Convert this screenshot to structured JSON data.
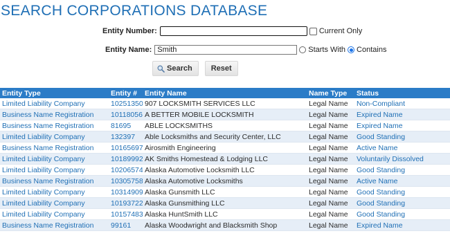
{
  "page": {
    "title": "SEARCH CORPORATIONS DATABASE"
  },
  "form": {
    "entity_number_label": "Entity Number:",
    "entity_number_value": "",
    "current_only_label": "Current Only",
    "current_only_checked": false,
    "entity_name_label": "Entity Name:",
    "entity_name_value": "Smith",
    "starts_with_label": "Starts With",
    "contains_label": "Contains",
    "match_mode": "Contains",
    "search_button": "Search",
    "reset_button": "Reset"
  },
  "table": {
    "headers": [
      "Entity Type",
      "Entity #",
      "Entity Name",
      "Name Type",
      "Status"
    ],
    "rows": [
      [
        "Limited Liability Company",
        "10251350",
        "907 LOCKSMITH SERVICES LLC",
        "Legal Name",
        "Non-Compliant"
      ],
      [
        "Business Name Registration",
        "10118056",
        "A BETTER MOBILE LOCKSMITH",
        "Legal Name",
        "Expired Name"
      ],
      [
        "Business Name Registration",
        "81695",
        "ABLE LOCKSMITHS",
        "Legal Name",
        "Expired Name"
      ],
      [
        "Limited Liability Company",
        "132397",
        "Able Locksmiths and Security Center, LLC",
        "Legal Name",
        "Good Standing"
      ],
      [
        "Business Name Registration",
        "10165697",
        "Airosmith Engineering",
        "Legal Name",
        "Active Name"
      ],
      [
        "Limited Liability Company",
        "10189992",
        "AK Smiths Homestead & Lodging LLC",
        "Legal Name",
        "Voluntarily Dissolved"
      ],
      [
        "Limited Liability Company",
        "10206574",
        "Alaska Automotive Locksmith LLC",
        "Legal Name",
        "Good Standing"
      ],
      [
        "Business Name Registration",
        "10305758",
        "Alaska Automotive Locksmiths",
        "Legal Name",
        "Active Name"
      ],
      [
        "Limited Liability Company",
        "10314909",
        "Alaska Gunsmith LLC",
        "Legal Name",
        "Good Standing"
      ],
      [
        "Limited Liability Company",
        "10193722",
        "Alaska Gunsmithing LLC",
        "Legal Name",
        "Good Standing"
      ],
      [
        "Limited Liability Company",
        "10157483",
        "Alaska HuntSmith LLC",
        "Legal Name",
        "Good Standing"
      ],
      [
        "Business Name Registration",
        "99161",
        "Alaska Woodwright and Blacksmith Shop",
        "Legal Name",
        "Expired Name"
      ]
    ]
  },
  "colors": {
    "accent": "#1f6fb5",
    "header_bg": "#2b7cc7",
    "alt_row_bg": "#e6eef7"
  }
}
